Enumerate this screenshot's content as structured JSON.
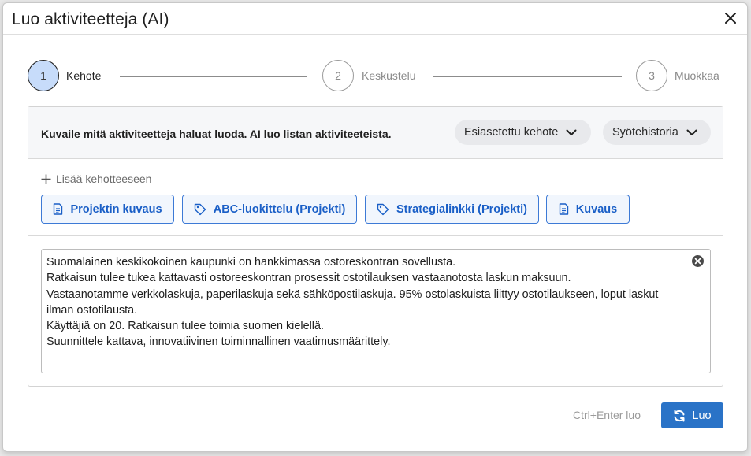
{
  "dialog": {
    "title": "Luo aktiviteetteja (AI)"
  },
  "stepper": {
    "steps": [
      {
        "number": "1",
        "label": "Kehote"
      },
      {
        "number": "2",
        "label": "Keskustelu"
      },
      {
        "number": "3",
        "label": "Muokkaa"
      }
    ],
    "active_step": 1
  },
  "prompt_panel": {
    "description": "Kuvaile mitä aktiviteetteja haluat luoda. AI luo listan aktiviteeteista.",
    "preset_dropdown": "Esiasetettu kehote",
    "history_dropdown": "Syötehistoria",
    "add_to_prompt": "Lisää kehotteeseen",
    "chips": [
      {
        "label": "Projektin kuvaus",
        "icon": "document-icon"
      },
      {
        "label": "ABC-luokittelu (Projekti)",
        "icon": "tag-icon"
      },
      {
        "label": "Strategialinkki (Projekti)",
        "icon": "tag-icon"
      },
      {
        "label": "Kuvaus",
        "icon": "document-icon"
      }
    ],
    "prompt_text": [
      "Suomalainen keskikokoinen kaupunki on hankkimassa ostoreskontran sovellusta.",
      "Ratkaisun tulee tukea kattavasti ostoreeskontran prosessit ostotilauksen vastaanotosta laskun maksuun.",
      "Vastaanotamme verkkolaskuja, paperilaskuja sekä sähköpostilaskuja. 95% ostolaskuista liittyy ostotilaukseen, loput laskut ilman ostotilausta.",
      "Käyttäjiä on 20. Ratkaisun tulee toimia suomen kielellä.",
      "Suunnittele kattava, innovatiivinen toiminnallinen vaatimusmäärittely."
    ]
  },
  "footer": {
    "shortcut_hint": "Ctrl+Enter luo",
    "submit_label": "Luo"
  },
  "colors": {
    "accent": "#2a73c7",
    "chip_text": "#1a5fc7",
    "active_step_fill": "#c7dcfa"
  }
}
